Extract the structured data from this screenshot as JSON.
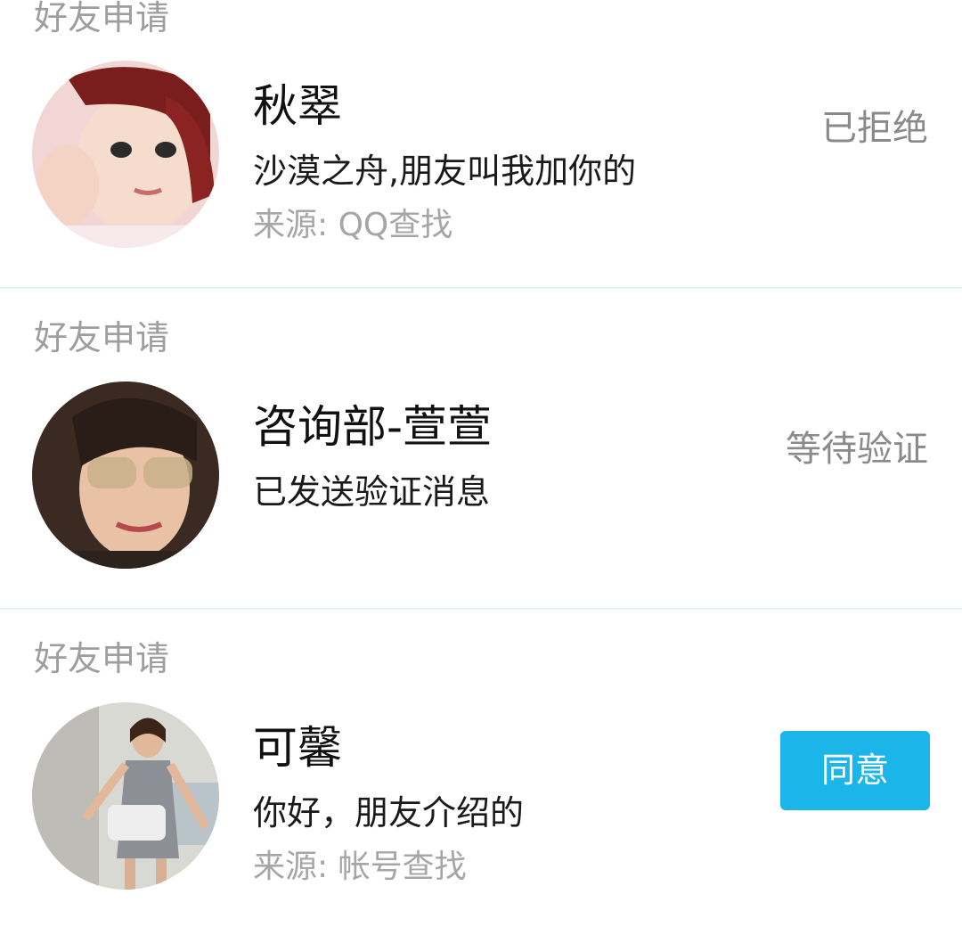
{
  "requests": [
    {
      "section_label": "好友申请",
      "name": "",
      "message": "",
      "source": "",
      "status": ""
    },
    {
      "section_label": "",
      "name": "秋翠",
      "message": "沙漠之舟,朋友叫我加你的",
      "source": "来源: QQ查找",
      "status": "已拒绝"
    },
    {
      "section_label": "好友申请",
      "name": "咨询部-萱萱",
      "message": "已发送验证消息",
      "source": "",
      "status": "等待验证"
    },
    {
      "section_label": "好友申请",
      "name": "可馨",
      "message": "你好，朋友介绍的",
      "source": "来源: 帐号查找",
      "action_label": "同意"
    }
  ],
  "colors": {
    "accent": "#1cb5e9",
    "divider": "#e6f3ea",
    "secondary_text": "#9e9e9e"
  }
}
